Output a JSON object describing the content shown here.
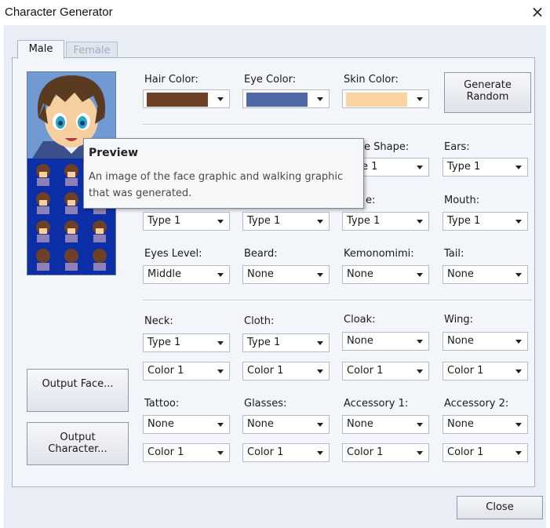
{
  "window": {
    "title": "Character Generator",
    "close_glyph": "×"
  },
  "tabs": [
    {
      "label": "Male",
      "active": true
    },
    {
      "label": "Female",
      "active": false
    }
  ],
  "colors": {
    "hair": "#6e4026",
    "eye": "#4e69a6",
    "skin": "#fad3a0",
    "accent": "#0c2fa8"
  },
  "top": {
    "hair_color": {
      "label": "Hair Color:"
    },
    "eye_color": {
      "label": "Eye Color:"
    },
    "skin_color": {
      "label": "Skin Color:"
    },
    "generate_random": "Generate Random"
  },
  "fields": {
    "face_shape": {
      "label_visible": "e Shape:",
      "value_visible": "e 1"
    },
    "ears": {
      "label": "Ears:",
      "value": "Type 1"
    },
    "row2_col3": {
      "label_visible": "e:"
    },
    "mouth": {
      "label": "Mouth:",
      "value": "Type 1"
    },
    "row2_values": [
      "Type 1",
      "Type 1",
      "Type 1"
    ],
    "eyes_level": {
      "label": "Eyes Level:",
      "value": "Middle"
    },
    "beard": {
      "label": "Beard:",
      "value": "None"
    },
    "kemonomimi": {
      "label": "Kemonomimi:",
      "value": "None"
    },
    "tail": {
      "label": "Tail:",
      "value": "None"
    },
    "neck": {
      "label": "Neck:",
      "value": "Type 1",
      "color": "Color 1"
    },
    "cloth": {
      "label": "Cloth:",
      "value": "Type 1",
      "color": "Color 1"
    },
    "cloak": {
      "label": "Cloak:",
      "value": "None",
      "color": "Color 1"
    },
    "wing": {
      "label": "Wing:",
      "value": "None",
      "color": "Color 1"
    },
    "tattoo": {
      "label": "Tattoo:",
      "value": "None",
      "color": "Color 1"
    },
    "glasses": {
      "label": "Glasses:",
      "value": "None",
      "color": "Color 1"
    },
    "accessory1": {
      "label": "Accessory 1:",
      "value": "None",
      "color": "Color 1"
    },
    "accessory2": {
      "label": "Accessory 2:",
      "value": "None",
      "color": "Color 1"
    }
  },
  "buttons": {
    "output_face": "Output Face...",
    "output_character": "Output Character...",
    "close": "Close"
  },
  "tooltip": {
    "title": "Preview",
    "line1": "An image of the face graphic and walking graphic",
    "line2": "that was generated."
  }
}
